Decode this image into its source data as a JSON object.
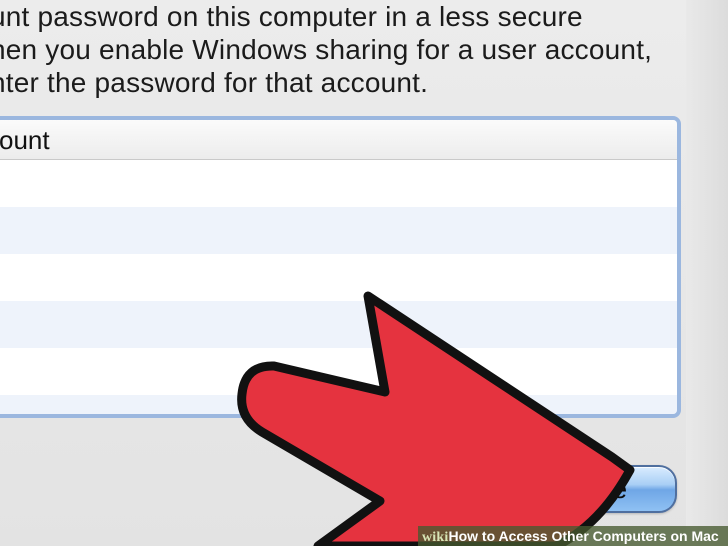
{
  "description": {
    "lines": [
      "unt password on this computer in a less secure",
      "hen you enable Windows sharing for a user account,",
      "nter the password for that account."
    ]
  },
  "table": {
    "column_header": "count",
    "rows_visible": 5
  },
  "buttons": {
    "done_label": "Done"
  },
  "watermark": {
    "brand": "wiki",
    "how": "How",
    "rest": " to Access Other Computers on Mac"
  },
  "colors": {
    "arrow_fill": "#e5333f",
    "arrow_stroke": "#111111",
    "table_border": "#9bb7df",
    "button_blue": "#6fa6e6",
    "watermark_bg": "#465a30"
  },
  "icons": {
    "arrow": "red-arrow-icon"
  }
}
